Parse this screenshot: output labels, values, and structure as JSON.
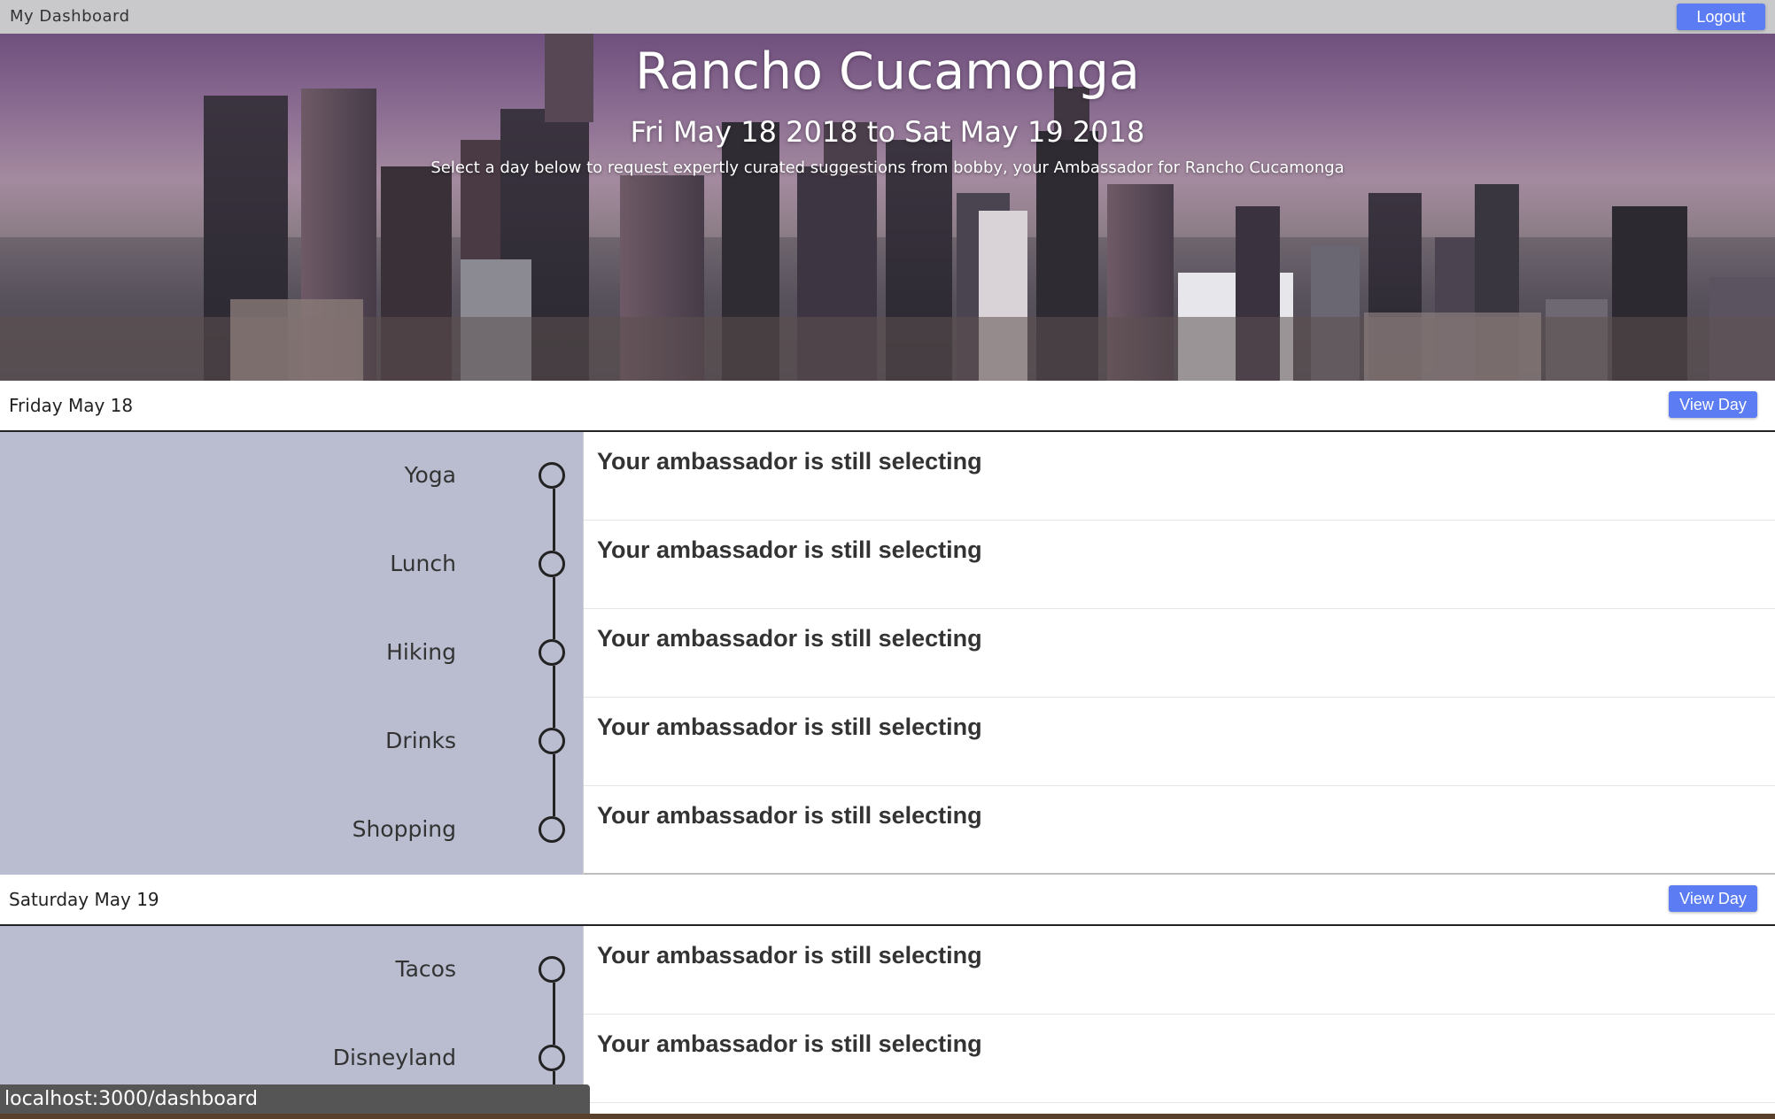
{
  "topbar": {
    "brand": "My Dashboard",
    "logout_label": "Logout"
  },
  "hero": {
    "city": "Rancho Cucamonga",
    "dates": "Fri May 18 2018 to Sat May 19 2018",
    "subtitle": "Select a day below to request expertly curated suggestions from bobby, your Ambassador for Rancho Cucamonga"
  },
  "days": [
    {
      "title": "Friday May 18",
      "view_label": "View Day",
      "items": [
        {
          "label": "Yoga",
          "message": "Your ambassador is still selecting"
        },
        {
          "label": "Lunch",
          "message": "Your ambassador is still selecting"
        },
        {
          "label": "Hiking",
          "message": "Your ambassador is still selecting"
        },
        {
          "label": "Drinks",
          "message": "Your ambassador is still selecting"
        },
        {
          "label": "Shopping",
          "message": "Your ambassador is still selecting"
        }
      ]
    },
    {
      "title": "Saturday May 19",
      "view_label": "View Day",
      "items": [
        {
          "label": "Tacos",
          "message": "Your ambassador is still selecting"
        },
        {
          "label": "Disneyland",
          "message": "Your ambassador is still selecting"
        }
      ]
    }
  ],
  "status_bar": {
    "url": "localhost:3000/dashboard"
  }
}
